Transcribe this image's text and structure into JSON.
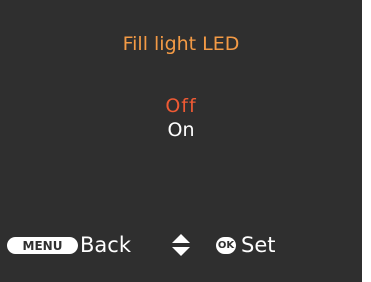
{
  "menu": {
    "title": "Fill light LED",
    "options": [
      {
        "label": "Off",
        "selected": true
      },
      {
        "label": "On",
        "selected": false
      }
    ]
  },
  "footer": {
    "menu_button": "MENU",
    "back_label": "Back",
    "updown_icon": "up-down-arrow-icon",
    "ok_button": "OK",
    "set_label": "Set"
  },
  "colors": {
    "background": "#2f2f2f",
    "title": "#f39a45",
    "selected": "#ef5a34",
    "text": "#ffffff"
  }
}
